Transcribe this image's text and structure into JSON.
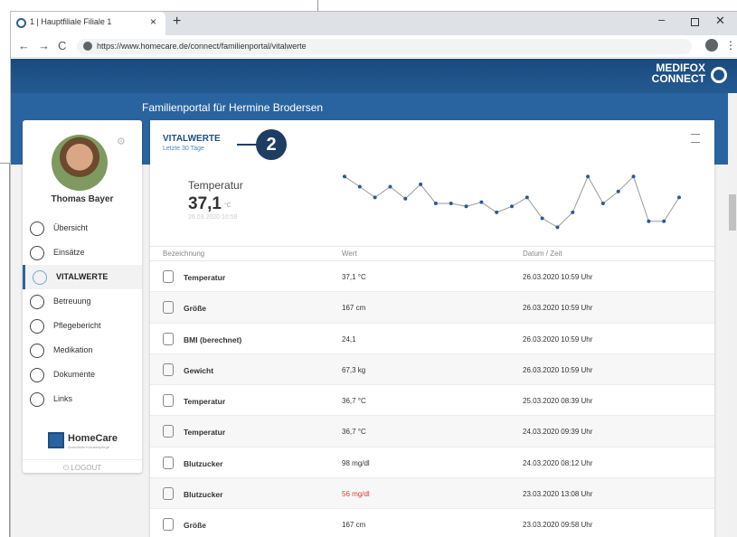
{
  "browser": {
    "tab_title": "1 | Hauptfiliale Filiale 1",
    "tab_close": "×",
    "new_tab": "+",
    "min": "–",
    "close": "✕",
    "back": "←",
    "forward": "→",
    "reload": "C",
    "url": "https://www.homecare.de/connect/familienportal/vitalwerte",
    "menu": "⋮"
  },
  "header": {
    "logo_line1": "MEDIFOX",
    "logo_line2": "CONNECT",
    "portal_title": "Familienportal für Hermine Brodersen"
  },
  "sidebar": {
    "user_name": "Thomas Bayer",
    "items": [
      {
        "label": "Übersicht",
        "icon": "overview-icon"
      },
      {
        "label": "Einsätze",
        "icon": "assignments-icon"
      },
      {
        "label": "VITALWERTE",
        "icon": "heart-icon"
      },
      {
        "label": "Betreuung",
        "icon": "care-icon"
      },
      {
        "label": "Pflegebericht",
        "icon": "report-icon"
      },
      {
        "label": "Medikation",
        "icon": "pill-icon"
      },
      {
        "label": "Dokumente",
        "icon": "document-icon"
      },
      {
        "label": "Links",
        "icon": "link-icon"
      }
    ],
    "homecare_name": "HomeCare",
    "homecare_sub": "Ambulante Krankenpflege",
    "logout": "LOGOUT"
  },
  "card": {
    "title": "VITALWERTE",
    "subtitle": "Letzte 30 Tage",
    "callout": "2",
    "summary_label": "Temperatur",
    "summary_value": "37,1",
    "summary_unit": "°C",
    "summary_date": "26.03.2020 10:59"
  },
  "table": {
    "headers": [
      "Bezeichnung",
      "Wert",
      "Datum / Zeit"
    ],
    "rows": [
      {
        "name": "Temperatur",
        "value": "37,1 °C",
        "date": "26.03.2020 10:59 Uhr",
        "icon": "thermometer-icon",
        "alert": false
      },
      {
        "name": "Größe",
        "value": "167 cm",
        "date": "26.03.2020 10:59 Uhr",
        "icon": "height-icon",
        "alert": false
      },
      {
        "name": "BMI (berechnet)",
        "value": "24,1",
        "date": "26.03.2020 10:59 Uhr",
        "icon": "bmi-icon",
        "alert": false
      },
      {
        "name": "Gewicht",
        "value": "67,3 kg",
        "date": "26.03.2020 10:59 Uhr",
        "icon": "scale-icon",
        "alert": false
      },
      {
        "name": "Temperatur",
        "value": "36,7 °C",
        "date": "25.03.2020 08:39 Uhr",
        "icon": "thermometer-icon",
        "alert": false
      },
      {
        "name": "Temperatur",
        "value": "36,7 °C",
        "date": "24.03.2020 09:39 Uhr",
        "icon": "thermometer-icon",
        "alert": false
      },
      {
        "name": "Blutzucker",
        "value": "98 mg/dl",
        "date": "24.03.2020 08:12 Uhr",
        "icon": "blood-sugar-icon",
        "alert": false
      },
      {
        "name": "Blutzucker",
        "value": "56 mg/dl",
        "date": "23.03.2020 13:08 Uhr",
        "icon": "blood-sugar-icon",
        "alert": true
      },
      {
        "name": "Größe",
        "value": "167 cm",
        "date": "23.03.2020 09:58 Uhr",
        "icon": "height-icon",
        "alert": false
      }
    ]
  },
  "colors": {
    "brand_dark": "#1f3d63",
    "brand": "#2a64a0",
    "point": "#2a5a94",
    "alert": "#e53935"
  },
  "sparkline": {
    "values": [
      0.95,
      0.78,
      0.6,
      0.78,
      0.58,
      0.82,
      0.5,
      0.5,
      0.45,
      0.52,
      0.35,
      0.45,
      0.6,
      0.25,
      0.1,
      0.35,
      0.95,
      0.5,
      0.7,
      0.95,
      0.2,
      0.2,
      0.6
    ]
  }
}
